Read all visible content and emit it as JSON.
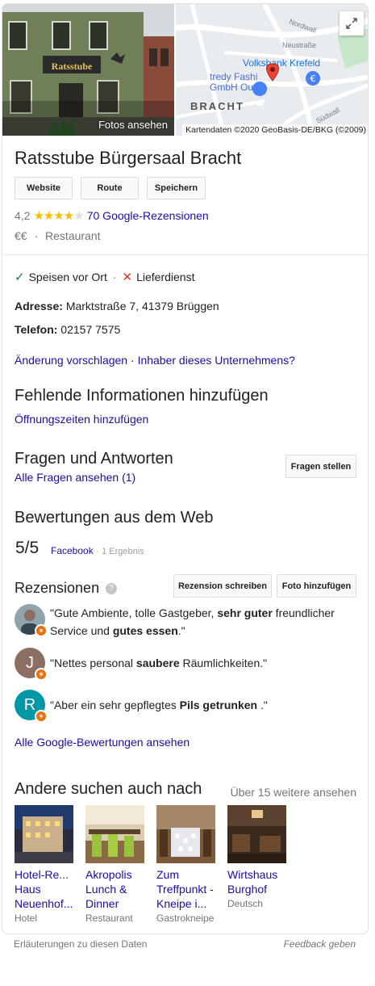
{
  "hero": {
    "photos_label": "Fotos ansehen",
    "sign_text": "Ratsstube",
    "map_labels": {
      "nordwall": "Nordwall",
      "neustrasse": "Neustraße",
      "volksbank": "Volksbank Krefeld",
      "tredy1": "tredy Fashi",
      "tredy2": "GmbH Outlet",
      "bracht": "BRACHT",
      "suedwall": "Südwall"
    },
    "attribution": "Kartendaten ©2020 GeoBasis-DE/BKG (©2009)"
  },
  "business": {
    "name": "Ratsstube Bürgersaal Bracht",
    "buttons": [
      "Website",
      "Route",
      "Speichern"
    ],
    "rating": "4,2",
    "stars_filled": 4,
    "reviews_link": "70 Google-Rezensionen",
    "price": "€€",
    "separator": "·",
    "category": "Restaurant"
  },
  "services": {
    "dine_in": "Speisen vor Ort",
    "dot": "·",
    "delivery": "Lieferdienst"
  },
  "details": {
    "address_label": "Adresse:",
    "address": "Marktstraße 7, 41379 Brüggen",
    "phone_label": "Telefon:",
    "phone": "02157 7575",
    "suggest": "Änderung vorschlagen",
    "link_sep": "·",
    "owner": "Inhaber dieses Unternehmens?"
  },
  "missing": {
    "heading": "Fehlende Informationen hinzufügen",
    "link": "Öffnungszeiten hinzufügen"
  },
  "qa": {
    "heading": "Fragen und Antworten",
    "link": "Alle Fragen ansehen (1)",
    "button": "Fragen stellen"
  },
  "web_reviews": {
    "heading": "Bewertungen aus dem Web",
    "score": "5/5",
    "source": "Facebook",
    "dot": "·",
    "count": "1 Ergebnis"
  },
  "reviews": {
    "heading": "Rezensionen",
    "help_icon": "?",
    "write_button": "Rezension schreiben",
    "photo_button": "Foto hinzufügen",
    "items": [
      {
        "initial": "",
        "color": "#cfd8dc",
        "parts": [
          "\"Gute Ambiente, tolle Gastgeber, ",
          "sehr guter",
          " freundlicher Service und ",
          "gutes essen",
          ".\""
        ]
      },
      {
        "initial": "J",
        "color": "#8d6e63",
        "parts": [
          "\"Nettes personal ",
          "saubere",
          " Räumlichkeiten.\"",
          "",
          ""
        ]
      },
      {
        "initial": "R",
        "color": "#0097a7",
        "parts": [
          "\"Aber ein sehr gepflegtes ",
          "Pils getrunken",
          " .\"",
          "",
          ""
        ]
      }
    ],
    "all_link": "Alle Google-Bewertungen ansehen"
  },
  "others": {
    "heading": "Andere suchen auch nach",
    "more": "Über 15 weitere ansehen",
    "items": [
      {
        "name": "Hotel-Re... Haus Neuenhof...",
        "type": "Hotel"
      },
      {
        "name": "Akropolis Lunch & Dinner",
        "type": "Restaurant"
      },
      {
        "name": "Zum Treffpunkt - Kneipe i...",
        "type": "Gastrokneipe"
      },
      {
        "name": "Wirtshaus Burghof",
        "type": "Deutsch"
      }
    ]
  },
  "footer": {
    "left": "Erläuterungen zu diesen Daten",
    "right": "Feedback geben"
  },
  "colors": {
    "link": "#1a0dab",
    "star": "#fbbc04",
    "pin": "#ea4335",
    "check": "#188038",
    "cross": "#d93025"
  }
}
